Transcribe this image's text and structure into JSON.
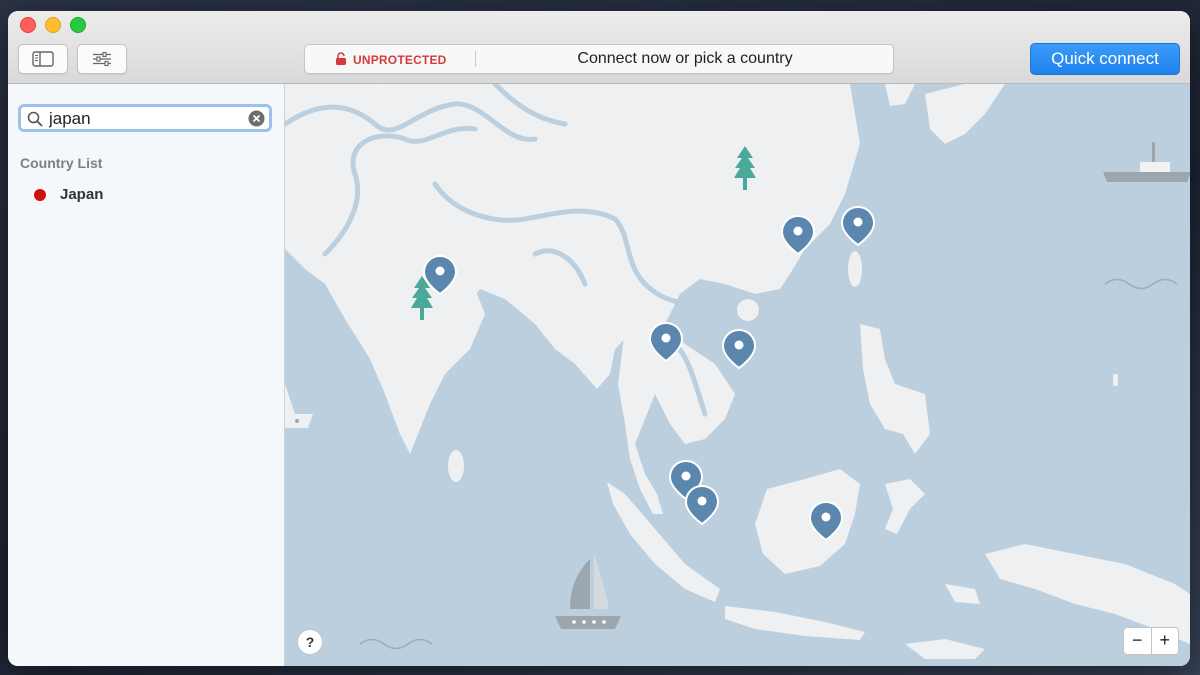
{
  "toolbar": {
    "status_text": "UNPROTECTED",
    "prompt": "Connect now or pick a country",
    "quick_connect_label": "Quick connect"
  },
  "sidebar": {
    "search_value": "japan",
    "section_title": "Country List",
    "countries": [
      {
        "name": "Japan"
      }
    ]
  },
  "map": {
    "help_label": "?",
    "zoom_out_label": "−",
    "zoom_in_label": "+"
  },
  "colors": {
    "accent": "#2a8af4",
    "unprotected": "#d43a3a",
    "pin": "#5b86ae",
    "land": "#eef0f1",
    "sea": "#bccfde",
    "tree": "#4aa99b"
  }
}
